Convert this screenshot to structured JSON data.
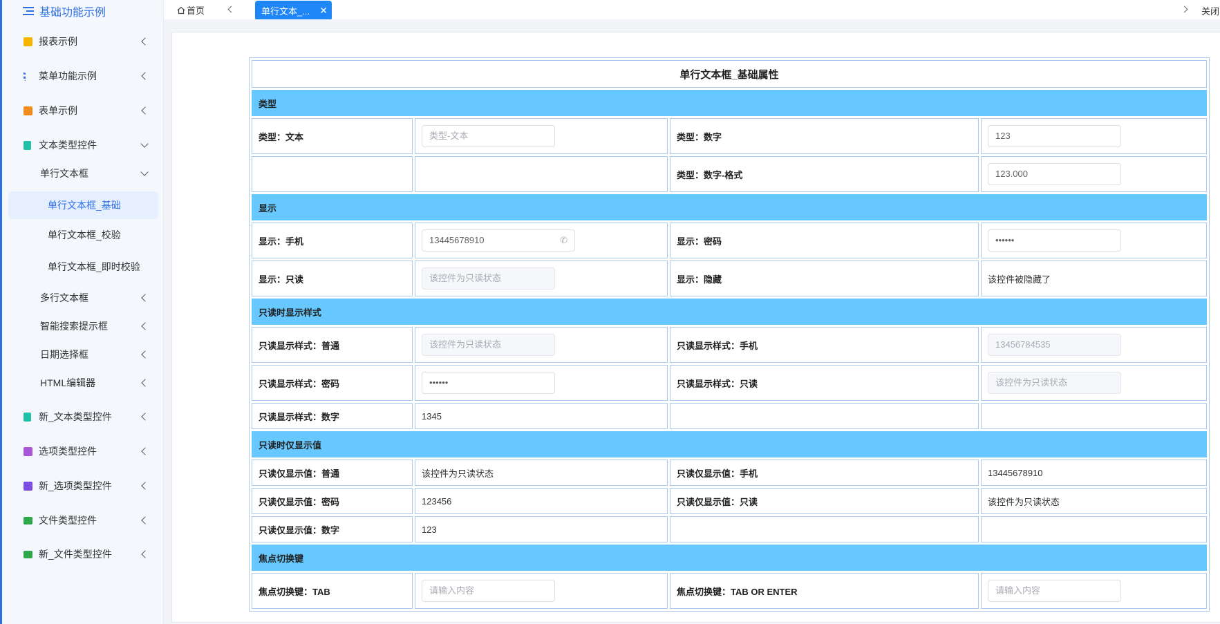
{
  "sidebar": {
    "title": "基础功能示例",
    "items": [
      {
        "label": "报表示例",
        "icon": "chart-icon"
      },
      {
        "label": "菜单功能示例",
        "icon": "list-icon"
      },
      {
        "label": "表单示例",
        "icon": "grid-icon"
      },
      {
        "label": "文本类型控件",
        "icon": "doc-icon"
      },
      {
        "label": "单行文本框"
      },
      {
        "label": "单行文本框_基础"
      },
      {
        "label": "单行文本框_校验"
      },
      {
        "label": "单行文本框_即时校验"
      },
      {
        "label": "多行文本框"
      },
      {
        "label": "智能搜索提示框"
      },
      {
        "label": "日期选择框"
      },
      {
        "label": "HTML编辑器"
      },
      {
        "label": "新_文本类型控件",
        "icon": "doc-icon"
      },
      {
        "label": "选项类型控件",
        "icon": "checkbox-icon"
      },
      {
        "label": "新_选项类型控件",
        "icon": "checkbox-icon"
      },
      {
        "label": "文件类型控件",
        "icon": "folder-icon"
      },
      {
        "label": "新_文件类型控件",
        "icon": "folder-icon"
      }
    ]
  },
  "tabs": {
    "home": "首页",
    "active": "单行文本_...",
    "close_all": "关闭"
  },
  "colors": {
    "accent": "#2f6fe4",
    "section": "#66c8fe",
    "active_tab": "#1e86f6"
  },
  "form": {
    "title": "单行文本框_基础属性",
    "sections": {
      "type": "类型",
      "display": "显示",
      "ro_style": "只读时显示样式",
      "ro_value": "只读时仅显示值",
      "focus": "焦点切换键"
    },
    "labels": {
      "type_text": "类型：文本",
      "type_number": "类型：数字",
      "type_number_fmt": "类型：数字-格式",
      "disp_phone": "显示：手机",
      "disp_password": "显示：密码",
      "disp_readonly": "显示：只读",
      "disp_hidden": "显示：隐藏",
      "ros_normal": "只读显示样式：普通",
      "ros_phone": "只读显示样式：手机",
      "ros_password": "只读显示样式：密码",
      "ros_readonly": "只读显示样式：只读",
      "ros_number": "只读显示样式：数字",
      "rov_normal": "只读仅显示值：普通",
      "rov_phone": "只读仅显示值：手机",
      "rov_password": "只读仅显示值：密码",
      "rov_readonly": "只读仅显示值：只读",
      "rov_number": "只读仅显示值：数字",
      "focus_tab": "焦点切换键：TAB",
      "focus_tab_enter": "焦点切换键：TAB OR ENTER"
    },
    "values": {
      "type_text_placeholder": "类型-文本",
      "type_number": "123",
      "type_number_fmt": "123.000",
      "disp_phone": "13445678910",
      "disp_password": "••••••",
      "disp_readonly": "该控件为只读状态",
      "disp_hidden": "该控件被隐藏了",
      "ros_normal": "该控件为只读状态",
      "ros_phone": "13456784535",
      "ros_password": "••••••",
      "ros_readonly": "该控件为只读状态",
      "ros_number": "1345",
      "rov_normal": "该控件为只读状态",
      "rov_phone": "13445678910",
      "rov_password": "123456",
      "rov_readonly": "该控件为只读状态",
      "rov_number": "123",
      "focus_placeholder": "请输入内容"
    }
  }
}
